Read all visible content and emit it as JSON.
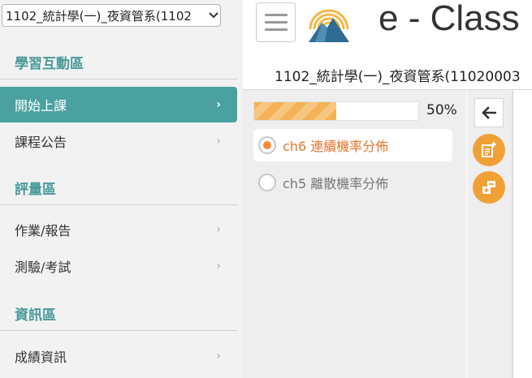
{
  "sidebar": {
    "course_select": {
      "value": "1102_統計學(一)_夜資管系(1102"
    },
    "sections": [
      {
        "title": "學習互動區"
      },
      {
        "title": "評量區"
      },
      {
        "title": "資訊區"
      }
    ],
    "items": [
      {
        "label": "開始上課",
        "active": true
      },
      {
        "label": "課程公告"
      },
      {
        "label": "作業/報告"
      },
      {
        "label": "測驗/考試"
      },
      {
        "label": "成績資訊"
      }
    ]
  },
  "header": {
    "brand": "e - Class",
    "course_title": "1102_統計學(一)_夜資管系(11020003"
  },
  "progress": {
    "value": 50,
    "label": "50%"
  },
  "chapters": [
    {
      "label": "ch6 連續機率分佈",
      "current": true
    },
    {
      "label": "ch5 離散機率分佈",
      "current": false
    }
  ],
  "colors": {
    "accent_teal": "#4aa19f",
    "accent_orange": "#f0a136",
    "chapter_active": "#e8732c"
  },
  "icons": [
    "chevron-down-icon",
    "chevron-right-icon",
    "hamburger-icon",
    "logo-icon",
    "back-arrow-icon",
    "add-note-icon",
    "add-item-icon"
  ]
}
